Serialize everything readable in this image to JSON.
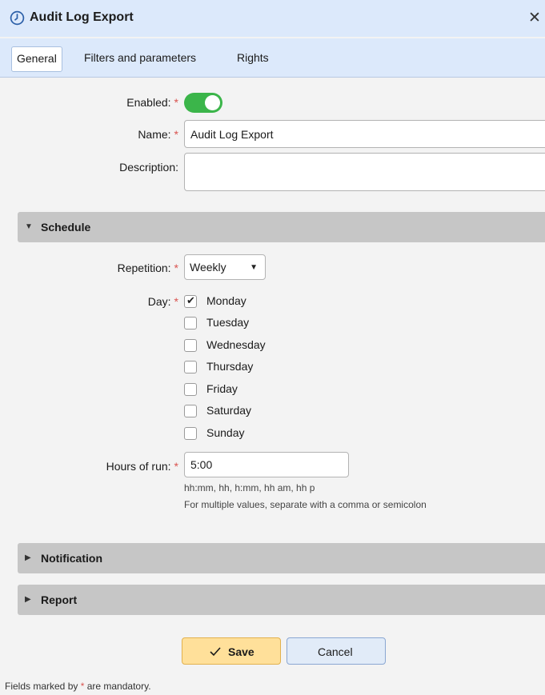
{
  "window": {
    "title": "Audit Log Export",
    "title_icon": "clock-icon",
    "close_glyph": "✕"
  },
  "tabs": [
    {
      "label": "General",
      "active": true
    },
    {
      "label": "Filters and parameters",
      "active": false
    },
    {
      "label": "Rights",
      "active": false
    }
  ],
  "general": {
    "enabled_label": "Enabled:",
    "enabled": true,
    "name_label": "Name:",
    "name_value": "Audit Log Export",
    "description_label": "Description:",
    "description_value": "",
    "required_marker": "*"
  },
  "schedule": {
    "title": "Schedule",
    "expanded": true,
    "repetition_label": "Repetition:",
    "repetition_value": "Weekly",
    "day_label": "Day:",
    "days": [
      {
        "label": "Monday",
        "checked": true
      },
      {
        "label": "Tuesday",
        "checked": false
      },
      {
        "label": "Wednesday",
        "checked": false
      },
      {
        "label": "Thursday",
        "checked": false
      },
      {
        "label": "Friday",
        "checked": false
      },
      {
        "label": "Saturday",
        "checked": false
      },
      {
        "label": "Sunday",
        "checked": false
      }
    ],
    "hours_label": "Hours of run:",
    "hours_value": "5:00",
    "hint_format": "hh:mm, hh, h:mm, hh am, hh p",
    "hint_multiple": "For multiple values, separate with a comma or semicolon"
  },
  "notification": {
    "title": "Notification",
    "expanded": false
  },
  "report": {
    "title": "Report",
    "expanded": false
  },
  "buttons": {
    "save": "Save",
    "cancel": "Cancel"
  },
  "footer": {
    "before": "Fields marked by ",
    "marker": "*",
    "after": " are mandatory."
  },
  "colors": {
    "accent": "#dce9fb",
    "toggle_on": "#3bb54a",
    "required": "#d9534f",
    "save_bg": "#ffe09a",
    "section_bg": "#c6c6c6"
  }
}
